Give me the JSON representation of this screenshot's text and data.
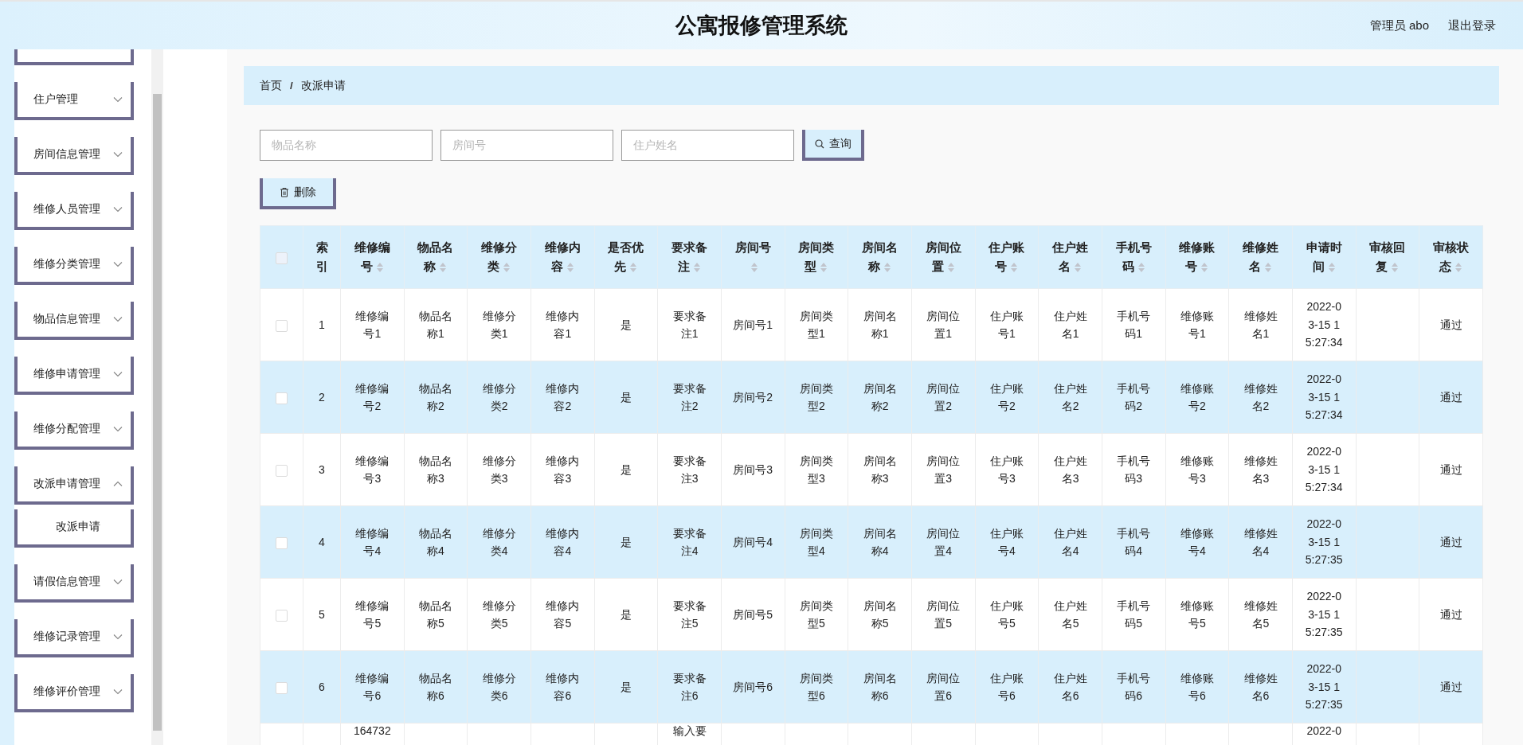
{
  "header": {
    "title": "公寓报修管理系统",
    "user": "管理员 abo",
    "logout": "退出登录"
  },
  "sidebar": {
    "items": [
      {
        "label": "住户管理",
        "expanded": false
      },
      {
        "label": "房间信息管理",
        "expanded": false
      },
      {
        "label": "维修人员管理",
        "expanded": false
      },
      {
        "label": "维修分类管理",
        "expanded": false
      },
      {
        "label": "物品信息管理",
        "expanded": false
      },
      {
        "label": "维修申请管理",
        "expanded": false
      },
      {
        "label": "维修分配管理",
        "expanded": false
      },
      {
        "label": "改派申请管理",
        "expanded": true,
        "children": [
          {
            "label": "改派申请",
            "selected": true
          }
        ]
      },
      {
        "label": "请假信息管理",
        "expanded": false
      },
      {
        "label": "维修记录管理",
        "expanded": false
      },
      {
        "label": "维修评价管理",
        "expanded": false
      }
    ]
  },
  "breadcrumb": {
    "separator": "/",
    "items": [
      "首页",
      "改派申请"
    ]
  },
  "search": {
    "fields": [
      {
        "placeholder": "物品名称"
      },
      {
        "placeholder": "房间号"
      },
      {
        "placeholder": "住户姓名"
      }
    ],
    "button": "查询"
  },
  "actions": {
    "delete": "删除"
  },
  "table": {
    "select_all": {
      "checked": false
    },
    "columns": [
      {
        "label": "索引",
        "sortable": false
      },
      {
        "label": "维修编号",
        "sortable": true
      },
      {
        "label": "物品名称",
        "sortable": true
      },
      {
        "label": "维修分类",
        "sortable": true
      },
      {
        "label": "维修内容",
        "sortable": true
      },
      {
        "label": "是否优先",
        "sortable": true
      },
      {
        "label": "要求备注",
        "sortable": true
      },
      {
        "label": "房间号",
        "sortable": true
      },
      {
        "label": "房间类型",
        "sortable": true
      },
      {
        "label": "房间名称",
        "sortable": true
      },
      {
        "label": "房间位置",
        "sortable": true
      },
      {
        "label": "住户账号",
        "sortable": true
      },
      {
        "label": "住户姓名",
        "sortable": true
      },
      {
        "label": "手机号码",
        "sortable": true
      },
      {
        "label": "维修账号",
        "sortable": true
      },
      {
        "label": "维修姓名",
        "sortable": true
      },
      {
        "label": "申请时间",
        "sortable": true
      },
      {
        "label": "审核回复",
        "sortable": true
      },
      {
        "label": "审核状态",
        "sortable": true
      }
    ],
    "rows": [
      {
        "checked": false,
        "cells": [
          "1",
          "维修编号1",
          "物品名称1",
          "维修分类1",
          "维修内容1",
          "是",
          "要求备注1",
          "房间号1",
          "房间类型1",
          "房间名称1",
          "房间位置1",
          "住户账号1",
          "住户姓名1",
          "手机号码1",
          "维修账号1",
          "维修姓名1",
          "2022-03-15 15:27:34",
          null,
          "通过"
        ]
      },
      {
        "checked": false,
        "cells": [
          "2",
          "维修编号2",
          "物品名称2",
          "维修分类2",
          "维修内容2",
          "是",
          "要求备注2",
          "房间号2",
          "房间类型2",
          "房间名称2",
          "房间位置2",
          "住户账号2",
          "住户姓名2",
          "手机号码2",
          "维修账号2",
          "维修姓名2",
          "2022-03-15 15:27:34",
          null,
          "通过"
        ]
      },
      {
        "checked": false,
        "cells": [
          "3",
          "维修编号3",
          "物品名称3",
          "维修分类3",
          "维修内容3",
          "是",
          "要求备注3",
          "房间号3",
          "房间类型3",
          "房间名称3",
          "房间位置3",
          "住户账号3",
          "住户姓名3",
          "手机号码3",
          "维修账号3",
          "维修姓名3",
          "2022-03-15 15:27:34",
          null,
          "通过"
        ]
      },
      {
        "checked": false,
        "cells": [
          "4",
          "维修编号4",
          "物品名称4",
          "维修分类4",
          "维修内容4",
          "是",
          "要求备注4",
          "房间号4",
          "房间类型4",
          "房间名称4",
          "房间位置4",
          "住户账号4",
          "住户姓名4",
          "手机号码4",
          "维修账号4",
          "维修姓名4",
          "2022-03-15 15:27:35",
          null,
          "通过"
        ]
      },
      {
        "checked": false,
        "cells": [
          "5",
          "维修编号5",
          "物品名称5",
          "维修分类5",
          "维修内容5",
          "是",
          "要求备注5",
          "房间号5",
          "房间类型5",
          "房间名称5",
          "房间位置5",
          "住户账号5",
          "住户姓名5",
          "手机号码5",
          "维修账号5",
          "维修姓名5",
          "2022-03-15 15:27:35",
          null,
          "通过"
        ]
      },
      {
        "checked": false,
        "cells": [
          "6",
          "维修编号6",
          "物品名称6",
          "维修分类6",
          "维修内容6",
          "是",
          "要求备注6",
          "房间号6",
          "房间类型6",
          "房间名称6",
          "房间位置6",
          "住户账号6",
          "住户姓名6",
          "手机号码6",
          "维修账号6",
          "维修姓名6",
          "2022-03-15 15:27:35",
          null,
          "通过"
        ]
      },
      {
        "partial": true,
        "cells": [
          null,
          "164732",
          null,
          null,
          null,
          null,
          "输入要",
          null,
          null,
          null,
          null,
          null,
          null,
          null,
          null,
          null,
          "2022-0",
          null,
          null
        ]
      }
    ]
  }
}
